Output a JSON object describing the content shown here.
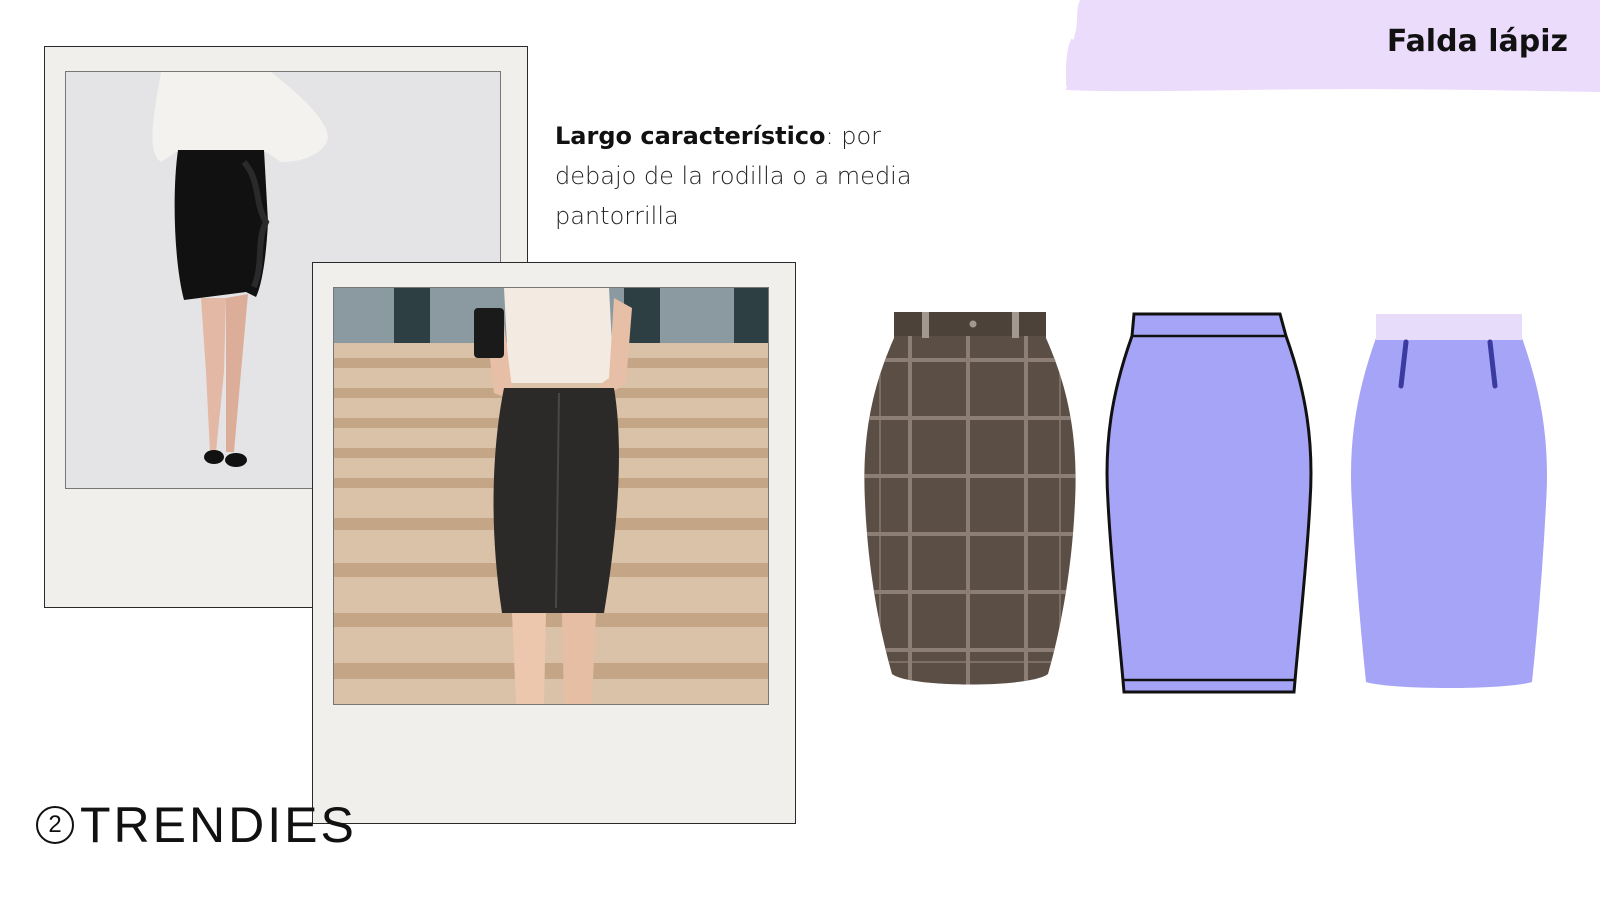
{
  "slide": {
    "title": "Falda lápiz",
    "description": {
      "bold": "Largo característico",
      "rest": ": por debajo de la rodilla o a media pantorrilla"
    }
  },
  "photos": [
    {
      "name": "ruffle-pencil-skirt-photo",
      "colors": {
        "skirt": "#111111",
        "blouse": "#f4f2ee",
        "background": "#e4e4e6"
      }
    },
    {
      "name": "leather-pencil-skirt-photo",
      "colors": {
        "skirt": "#2b2a28",
        "top": "#f3ebe2",
        "background": "#d9c2a8"
      }
    }
  ],
  "illustrations": [
    {
      "name": "plaid-pencil-skirt",
      "color": "#5b4e45",
      "accent": "#8c7e75"
    },
    {
      "name": "outline-pencil-skirt",
      "color": "#a5a4f6",
      "outline": "#111111"
    },
    {
      "name": "flat-pencil-skirt",
      "color": "#a5a4f6",
      "waistband": "#e8dcfb",
      "darts": "#3b3aa0"
    }
  ],
  "colors": {
    "accent_brush": "#ecdcfb",
    "polaroid_frame": "#f0efeb",
    "text": "#111111"
  },
  "brand": {
    "logo_number": "2",
    "logo_text": "TRENDIES"
  }
}
